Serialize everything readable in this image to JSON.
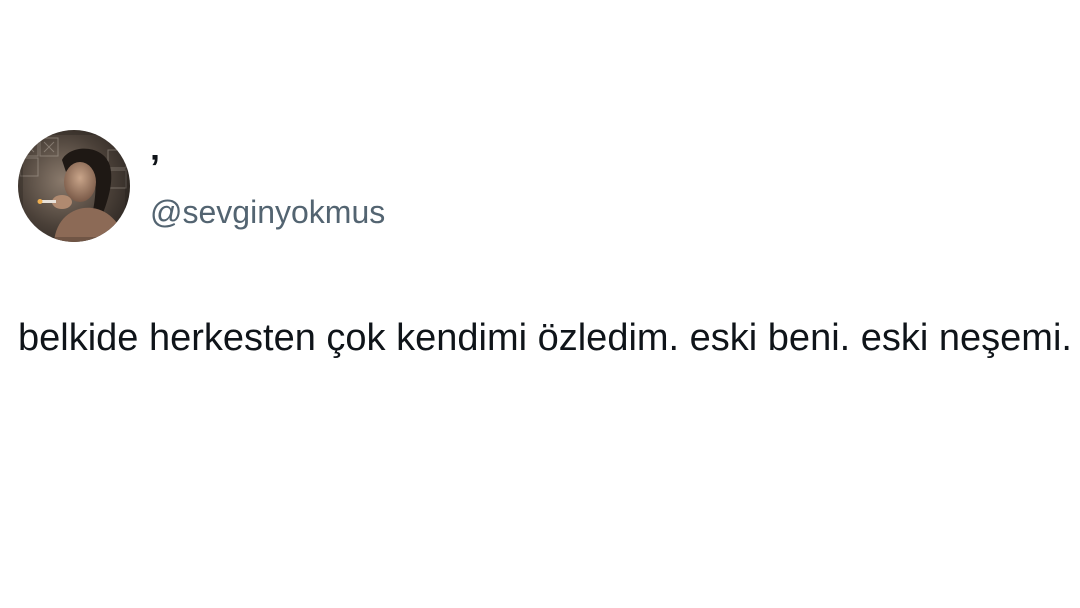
{
  "tweet": {
    "display_name": "’",
    "handle": "@sevginyokmus",
    "text": "belkide herkesten çok kendimi özledim. eski beni. eski neşemi.",
    "avatar_icon": "profile-photo"
  },
  "colors": {
    "background": "#ffffff",
    "text": "#0f1419",
    "handle": "#536471"
  }
}
